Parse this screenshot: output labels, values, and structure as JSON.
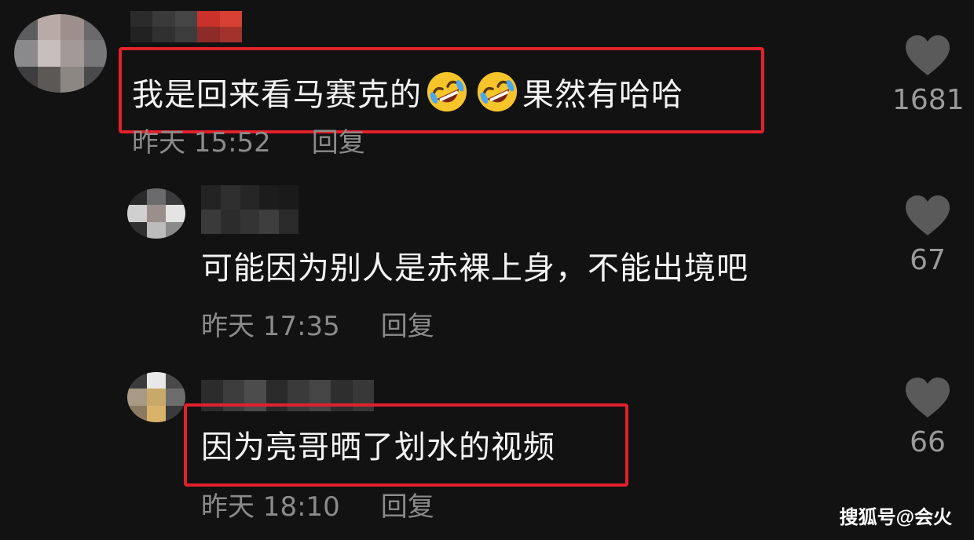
{
  "comments": [
    {
      "text_before": "我是回来看马赛克的",
      "emojis": [
        "rolling-laughing-emoji",
        "rolling-laughing-emoji"
      ],
      "text_after": "果然有哈哈",
      "time": "昨天 15:52",
      "reply_label": "回复",
      "likes": "1681",
      "highlighted": true
    },
    {
      "text": "可能因为别人是赤裸上身，不能出境吧",
      "time": "昨天 17:35",
      "reply_label": "回复",
      "likes": "67",
      "highlighted": false
    },
    {
      "text": "因为亮哥晒了划水的视频",
      "time": "昨天 18:10",
      "reply_label": "回复",
      "likes": "66",
      "highlighted": true
    }
  ],
  "watermark": "搜狐号@会火",
  "colors": {
    "background": "#121213",
    "highlight": "#e2212b",
    "meta_text": "#8b8b8b",
    "heart": "#5a5a5a"
  }
}
